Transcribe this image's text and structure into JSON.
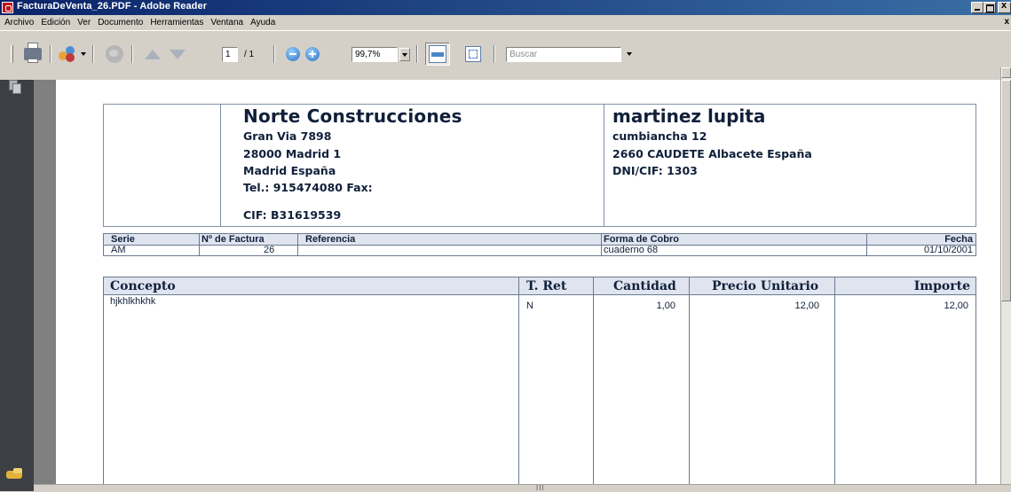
{
  "window": {
    "title": "FacturaDeVenta_26.PDF - Adobe Reader",
    "close_doc": "x"
  },
  "menu": [
    "Archivo",
    "Edición",
    "Ver",
    "Documento",
    "Herramientas",
    "Ventana",
    "Ayuda"
  ],
  "toolbar": {
    "page_current": "1",
    "page_total": "/ 1",
    "zoom": "99,7%",
    "search_placeholder": "Buscar"
  },
  "scrollbar": {
    "grip": "III"
  },
  "invoice": {
    "company": {
      "name": "Norte Construcciones",
      "address": "Gran Via 7898",
      "city": "28000  Madrid 1",
      "region": "Madrid  España",
      "phone": "Tel.: 915474080  Fax:",
      "cif": "CIF: B31619539"
    },
    "client": {
      "name": "martinez lupita",
      "address": "cumbiancha 12",
      "city": "2660  CAUDETE  Albacete  España",
      "dni": "DNI/CIF: 1303"
    },
    "meta_labels": {
      "serie": "Serie",
      "numero": "Nº de Factura",
      "referencia": "Referencia",
      "forma_cobro": "Forma de Cobro",
      "fecha": "Fecha"
    },
    "meta_values": {
      "serie": "AM",
      "numero": "26",
      "referencia": "",
      "forma_cobro": "cuaderno 68",
      "fecha": "01/10/2001"
    },
    "columns": [
      "Concepto",
      "T. Ret",
      "Cantidad",
      "Precio Unitario",
      "Importe"
    ],
    "rows": [
      {
        "concepto": "hjkhlkhkhk",
        "t_ret": "N",
        "cantidad": "1,00",
        "precio": "12,00",
        "importe": "12,00"
      }
    ]
  }
}
